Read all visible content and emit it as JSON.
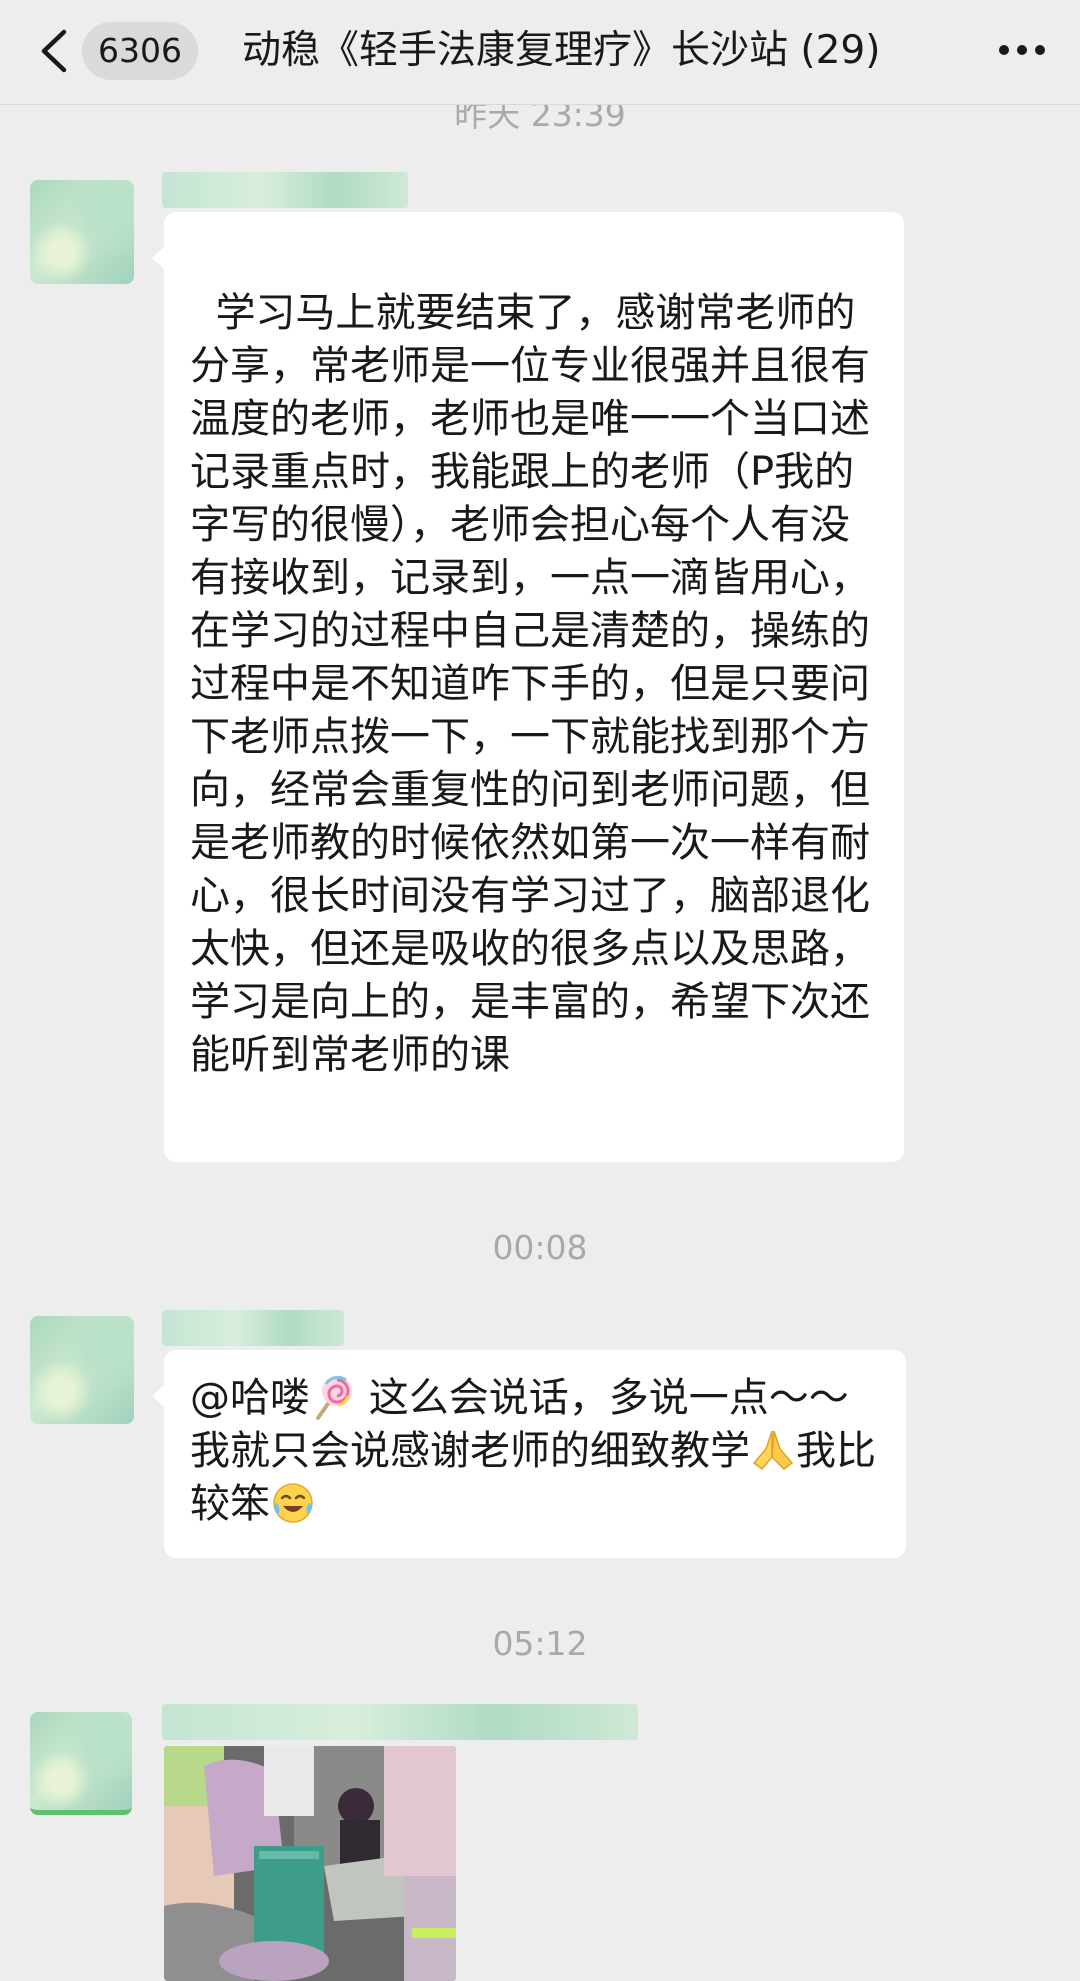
{
  "header": {
    "back_icon": "chevron-left-icon",
    "unread_count": "6306",
    "title": "动稳《轻手法康复理疗》长沙站 (29)",
    "more_icon": "more-icon"
  },
  "timestamps": {
    "t1": "昨天 23:39",
    "t2": "00:08",
    "t3": "05:12"
  },
  "messages": [
    {
      "text": "学习马上就要结束了，感谢常老师的分享，常老师是一位专业很强并且很有温度的老师，老师也是唯一一个当口述记录重点时，我能跟上的老师（P我的字写的很慢），老师会担心每个人有没有接收到，记录到，一点一滴皆用心，在学习的过程中自己是清楚的，操练的过程中是不知道咋下手的，但是只要问下老师点拨一下，一下就能找到那个方向，经常会重复性的问到老师问题，但是老师教的时候依然如第一次一样有耐心，很长时间没有学习过了，脑部退化太快，但还是吸收的很多点以及思路，学习是向上的，是丰富的，希望下次还能听到常老师的课"
    },
    {
      "part1": "@哈喽",
      "emoji1": "lollipop-icon",
      "part2": " 这么会说话，多说一点～～我就只会说感谢老师的细致教学",
      "emoji2": "pray-hands-icon",
      "part3": "我比较笨",
      "emoji3": "tears-of-joy-icon"
    },
    {
      "image": "photo-message"
    }
  ],
  "colors": {
    "background": "#ededed",
    "bubble": "#ffffff",
    "timestamp": "#a9a9a9"
  }
}
